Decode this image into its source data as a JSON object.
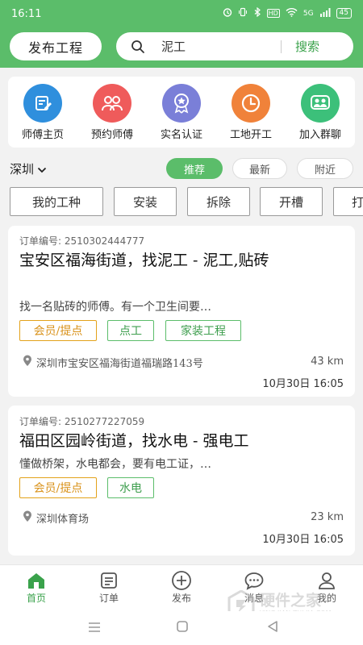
{
  "status_bar": {
    "time": "16:11",
    "signal_label": "5G",
    "hd_label": "HD",
    "battery": "45"
  },
  "header": {
    "publish_label": "发布工程",
    "search_value": "泥工",
    "search_button": "搜索"
  },
  "quick_actions": [
    {
      "label": "师傅主页",
      "icon": "edit-profile-icon",
      "color": "#2f8fdd"
    },
    {
      "label": "预约师傅",
      "icon": "group-icon",
      "color": "#ef5b5b"
    },
    {
      "label": "实名认证",
      "icon": "badge-star-icon",
      "color": "#7a7fd8"
    },
    {
      "label": "工地开工",
      "icon": "clock-icon",
      "color": "#f0823a"
    },
    {
      "label": "加入群聊",
      "icon": "chat-group-icon",
      "color": "#3cc07a"
    }
  ],
  "filters": {
    "city": "深圳",
    "tabs": [
      "推荐",
      "最新",
      "附近"
    ],
    "active_tab": "推荐"
  },
  "work_tags": [
    "我的工种",
    "安装",
    "拆除",
    "开槽",
    "打"
  ],
  "orders": [
    {
      "order_no": "订单编号: 2510302444777",
      "title": "宝安区福海街道，找泥工 - 泥工,贴砖",
      "desc": "找一名贴砖的师傅。有一个卫生间要…",
      "tags": [
        {
          "label": "会员/提点",
          "style": "gold"
        },
        {
          "label": "点工",
          "style": "green"
        },
        {
          "label": "家装工程",
          "style": "green"
        }
      ],
      "address": "深圳市宝安区福海街道福瑞路143号",
      "distance": "43 km",
      "time": "10月30日  16:05"
    },
    {
      "order_no": "订单编号: 2510277227059",
      "title": "福田区园岭街道，找水电 - 强电工",
      "desc": "懂做桥架，水电都会，要有电工证，…",
      "tags": [
        {
          "label": "会员/提点",
          "style": "gold"
        },
        {
          "label": "水电",
          "style": "green"
        }
      ],
      "address": "深圳体育场",
      "distance": "23 km",
      "time": "10月30日  16:05"
    }
  ],
  "tabbar": [
    {
      "label": "首页",
      "icon": "home-icon",
      "active": true
    },
    {
      "label": "订单",
      "icon": "order-icon",
      "active": false
    },
    {
      "label": "发布",
      "icon": "plus-circle-icon",
      "active": false
    },
    {
      "label": "消息",
      "icon": "message-icon",
      "active": false
    },
    {
      "label": "我的",
      "icon": "user-icon",
      "active": false
    }
  ],
  "watermark": {
    "main": "硬件之家",
    "sub": "YING JIAN ZHI JIA.COM"
  },
  "colors": {
    "brand_green": "#5bbd6a",
    "accent_green_text": "#3aa24b",
    "gold": "#e3a21a"
  }
}
